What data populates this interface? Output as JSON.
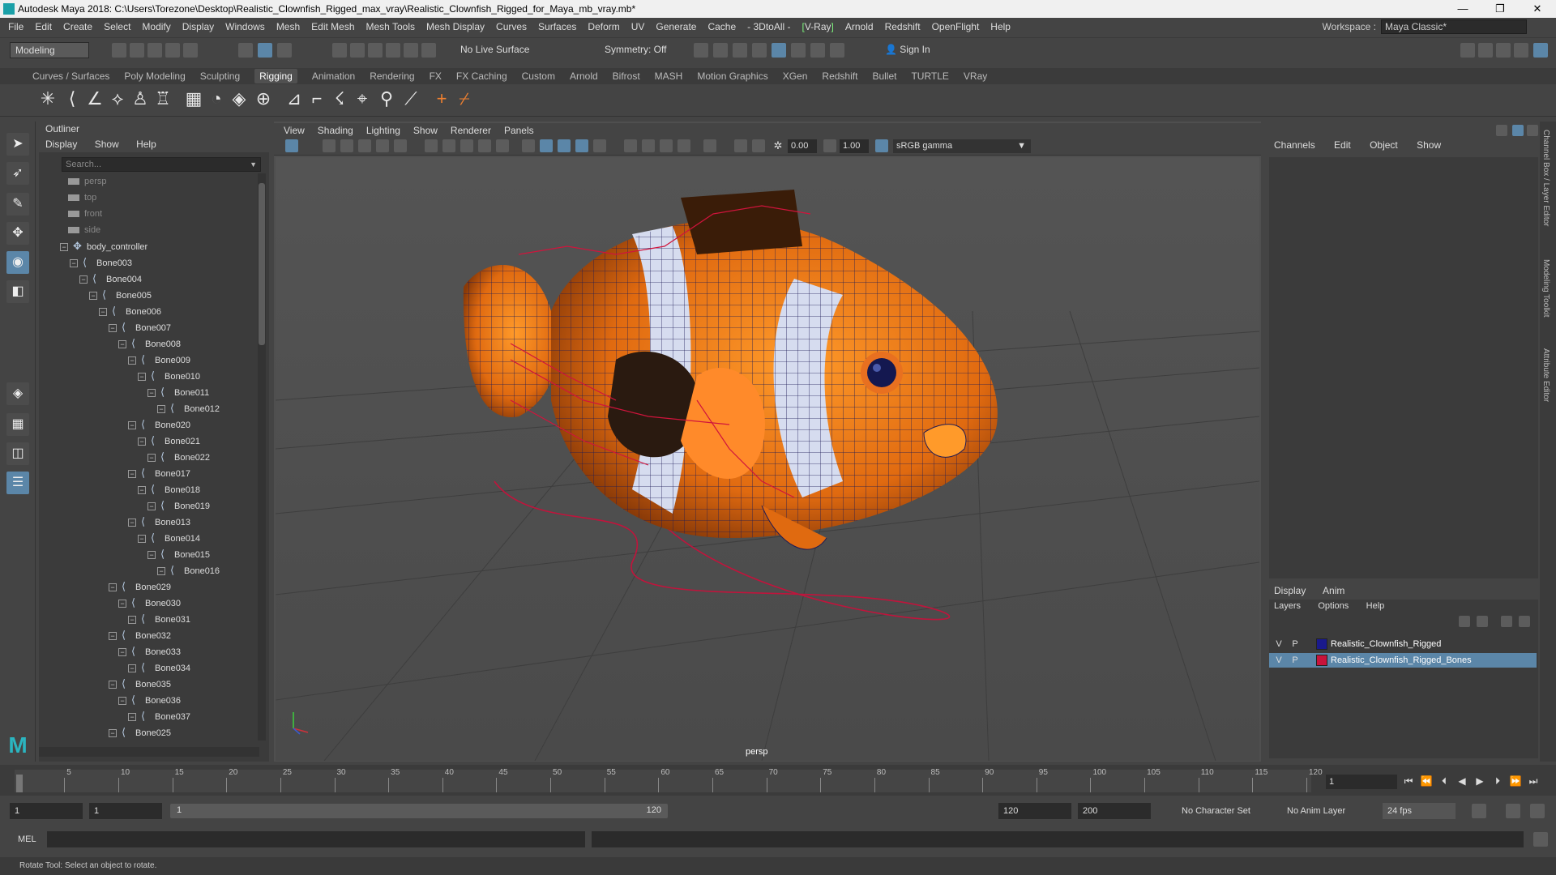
{
  "window": {
    "title": "Autodesk Maya 2018: C:\\Users\\Torezone\\Desktop\\Realistic_Clownfish_Rigged_max_vray\\Realistic_Clownfish_Rigged_for_Maya_mb_vray.mb*"
  },
  "menubar": {
    "items": [
      "File",
      "Edit",
      "Create",
      "Select",
      "Modify",
      "Display",
      "Windows",
      "Mesh",
      "Edit Mesh",
      "Mesh Tools",
      "Mesh Display",
      "Curves",
      "Surfaces",
      "Deform",
      "UV",
      "Generate",
      "Cache",
      "- 3DtoAll -",
      "V-Ray",
      "Arnold",
      "Redshift",
      "OpenFlight",
      "Help"
    ],
    "workspace_label": "Workspace :",
    "workspace_value": "Maya Classic*"
  },
  "statusline": {
    "mode": "Modeling",
    "live_surface": "No Live Surface",
    "symmetry": "Symmetry: Off",
    "sign_in": "Sign In"
  },
  "shelf": {
    "tabs": [
      "Curves / Surfaces",
      "Poly Modeling",
      "Sculpting",
      "Rigging",
      "Animation",
      "Rendering",
      "FX",
      "FX Caching",
      "Custom",
      "Arnold",
      "Bifrost",
      "MASH",
      "Motion Graphics",
      "XGen",
      "Redshift",
      "Bullet",
      "TURTLE",
      "VRay"
    ],
    "active": "Rigging"
  },
  "outliner": {
    "title": "Outliner",
    "menu": [
      "Display",
      "Show",
      "Help"
    ],
    "search_placeholder": "Search...",
    "items": [
      {
        "label": "persp",
        "type": "camera",
        "depth": 0
      },
      {
        "label": "top",
        "type": "camera",
        "depth": 0
      },
      {
        "label": "front",
        "type": "camera",
        "depth": 0
      },
      {
        "label": "side",
        "type": "camera",
        "depth": 0
      },
      {
        "label": "body_controller",
        "type": "controller",
        "depth": 0
      },
      {
        "label": "Bone003",
        "type": "bone",
        "depth": 1
      },
      {
        "label": "Bone004",
        "type": "bone",
        "depth": 2
      },
      {
        "label": "Bone005",
        "type": "bone",
        "depth": 3
      },
      {
        "label": "Bone006",
        "type": "bone",
        "depth": 4
      },
      {
        "label": "Bone007",
        "type": "bone",
        "depth": 5
      },
      {
        "label": "Bone008",
        "type": "bone",
        "depth": 6
      },
      {
        "label": "Bone009",
        "type": "bone",
        "depth": 7
      },
      {
        "label": "Bone010",
        "type": "bone",
        "depth": 8
      },
      {
        "label": "Bone011",
        "type": "bone",
        "depth": 9
      },
      {
        "label": "Bone012",
        "type": "bone",
        "depth": 10
      },
      {
        "label": "Bone020",
        "type": "bone",
        "depth": 7
      },
      {
        "label": "Bone021",
        "type": "bone",
        "depth": 8
      },
      {
        "label": "Bone022",
        "type": "bone",
        "depth": 9
      },
      {
        "label": "Bone017",
        "type": "bone",
        "depth": 7
      },
      {
        "label": "Bone018",
        "type": "bone",
        "depth": 8
      },
      {
        "label": "Bone019",
        "type": "bone",
        "depth": 9
      },
      {
        "label": "Bone013",
        "type": "bone",
        "depth": 7
      },
      {
        "label": "Bone014",
        "type": "bone",
        "depth": 8
      },
      {
        "label": "Bone015",
        "type": "bone",
        "depth": 9
      },
      {
        "label": "Bone016",
        "type": "bone",
        "depth": 10
      },
      {
        "label": "Bone029",
        "type": "bone",
        "depth": 5
      },
      {
        "label": "Bone030",
        "type": "bone",
        "depth": 6
      },
      {
        "label": "Bone031",
        "type": "bone",
        "depth": 7
      },
      {
        "label": "Bone032",
        "type": "bone",
        "depth": 5
      },
      {
        "label": "Bone033",
        "type": "bone",
        "depth": 6
      },
      {
        "label": "Bone034",
        "type": "bone",
        "depth": 7
      },
      {
        "label": "Bone035",
        "type": "bone",
        "depth": 5
      },
      {
        "label": "Bone036",
        "type": "bone",
        "depth": 6
      },
      {
        "label": "Bone037",
        "type": "bone",
        "depth": 7
      },
      {
        "label": "Bone025",
        "type": "bone",
        "depth": 5
      }
    ]
  },
  "viewport": {
    "menu": [
      "View",
      "Shading",
      "Lighting",
      "Show",
      "Renderer",
      "Panels"
    ],
    "exposure": "0.00",
    "gamma_value": "1.00",
    "color_space": "sRGB gamma",
    "camera_label": "persp"
  },
  "channelbox": {
    "menu": [
      "Channels",
      "Edit",
      "Object",
      "Show"
    ]
  },
  "layers": {
    "tabs": [
      "Display",
      "Anim"
    ],
    "menu": [
      "Layers",
      "Options",
      "Help"
    ],
    "rows": [
      {
        "v": "V",
        "p": "P",
        "color": "#1a1a8c",
        "name": "Realistic_Clownfish_Rigged",
        "selected": false
      },
      {
        "v": "V",
        "p": "P",
        "color": "#c8143c",
        "name": "Realistic_Clownfish_Rigged_Bones",
        "selected": true
      }
    ]
  },
  "sidetabs": [
    "Channel Box / Layer Editor",
    "Modeling Toolkit",
    "Attribute Editor"
  ],
  "timeline": {
    "ticks": [
      "1",
      "5",
      "10",
      "15",
      "20",
      "25",
      "30",
      "35",
      "40",
      "45",
      "50",
      "55",
      "60",
      "65",
      "70",
      "75",
      "80",
      "85",
      "90",
      "95",
      "100",
      "105",
      "110",
      "115",
      "120"
    ],
    "current_frame": "1"
  },
  "range": {
    "start": "1",
    "playback_start": "1",
    "slider_start": "1",
    "slider_end": "120",
    "playback_end": "120",
    "end": "200",
    "character_set": "No Character Set",
    "anim_layer": "No Anim Layer",
    "fps": "24 fps"
  },
  "cmdline": {
    "label": "MEL"
  },
  "helpline": {
    "text": "Rotate Tool: Select an object to rotate."
  }
}
